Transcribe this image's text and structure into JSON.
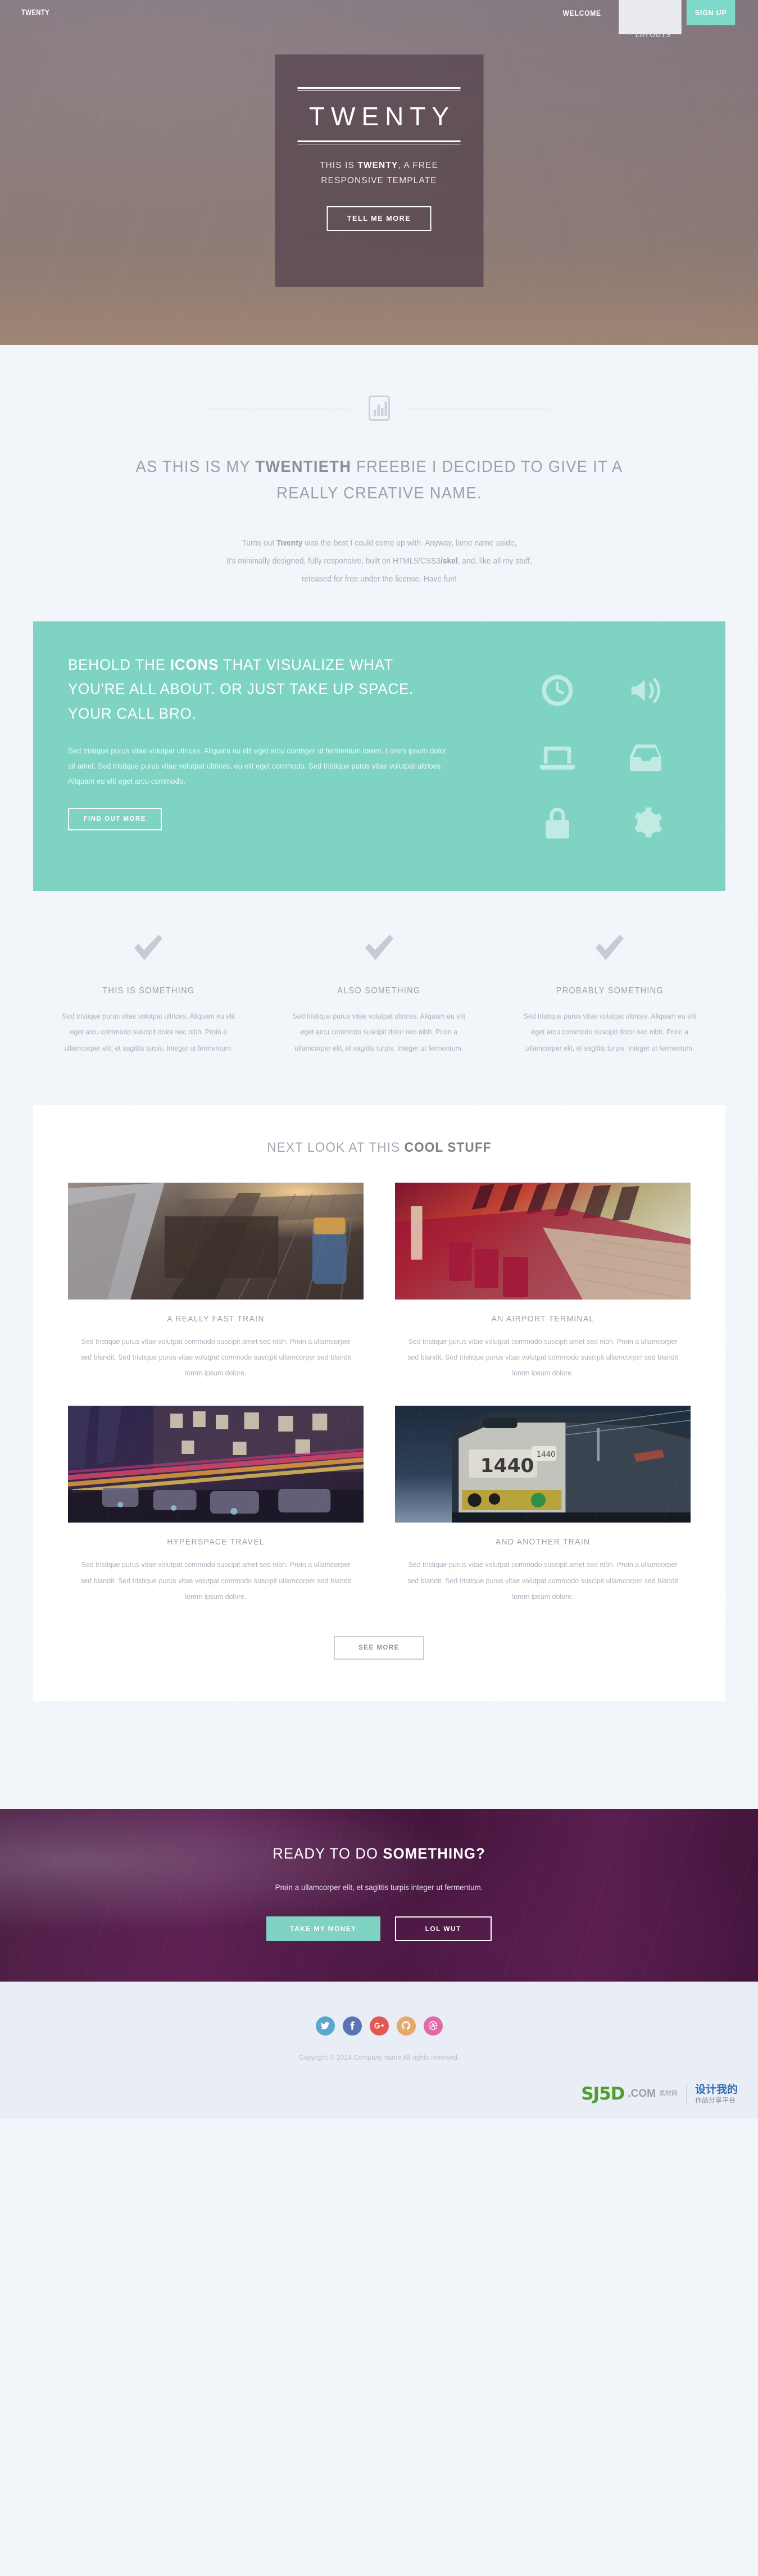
{
  "header": {
    "brand": "TWENTY",
    "nav": [
      {
        "label": "WELCOME",
        "style": "bold",
        "icon": null
      },
      {
        "label": "LAYOUTS",
        "style": "light",
        "icon": "chevron-down-icon"
      }
    ],
    "signup_label": "SIGN UP",
    "accent_teal": "#7ed3c3"
  },
  "hero": {
    "title": "TWENTY",
    "subtitle_pre": "THIS IS ",
    "subtitle_strong": "TWENTY",
    "subtitle_post": ", A FREE RESPONSIVE TEMPLATE",
    "button_label": "TELL ME MORE"
  },
  "intro": {
    "icon": "bar-chart-icon",
    "heading_pre": "AS THIS IS MY ",
    "heading_strong": "TWENTIETH",
    "heading_post": " FREEBIE I DECIDED TO GIVE IT A REALLY CREATIVE NAME.",
    "body_line1_pre": "Turns out ",
    "body_line1_strong": "Twenty",
    "body_line1_post": " was the best I could come up with. Anyway, lame name aside,",
    "body_line2_pre": "it's minimally designed, fully responsive, built on HTML5/CSS3",
    "body_line2_strong": "/skel",
    "body_line2_post": ", and, like all my stuff,",
    "body_line3": "released for free under the license. Have fun!"
  },
  "feature": {
    "bg_color": "#7ed3c3",
    "heading_pre": "BEHOLD THE ",
    "heading_strong": "ICONS",
    "heading_post": " THAT VISUALIZE WHAT YOU'RE ALL ABOUT. OR JUST TAKE UP SPACE. YOUR CALL BRO.",
    "paragraph": "Sed tristique purus vitae volutpat ultrices. Aliquam eu elit eget arcu contnger ut fermentum lorem. Lorem ipsum dolor sit amet. Sed tristique purus vitae volutpat ultrices. eu elit eget commodo. Sed tristique purus vitae volutpat ultrices. Aliquam eu elit eget arcu commodo.",
    "button_label": "FIND OUT MORE",
    "icons": [
      "clock-icon",
      "volume-icon",
      "laptop-icon",
      "inbox-icon",
      "lock-icon",
      "gear-icon"
    ]
  },
  "checks": {
    "body": "Sed tristique purus vitae volutpat ultrices. Aliquam eu elit eget arcu commodo suscipit dolor nec nibh. Proin a ullamcorper elit, et sagittis turpis. Integer ut fermentum.",
    "items": [
      {
        "icon": "check-icon",
        "title": "THIS IS SOMETHING"
      },
      {
        "icon": "check-icon",
        "title": "ALSO SOMETHING"
      },
      {
        "icon": "check-icon",
        "title": "PROBABLY SOMETHING"
      }
    ]
  },
  "gallery": {
    "heading_pre": "NEXT LOOK AT THIS ",
    "heading_strong": "COOL STUFF",
    "card_body": "Sed tristique purus vitae volutpat commodo suscipit amet sed nibh. Proin a ullamcorper sed blandit. Sed tristique purus vitae volutpat commodo suscipit ullamcorper sed blandit lorem ipsum dolore.",
    "cards": [
      {
        "title": "A REALLY FAST TRAIN",
        "image": "train-tracks-sunset-photo"
      },
      {
        "title": "AN AIRPORT TERMINAL",
        "image": "airport-terminal-red-seats-photo"
      },
      {
        "title": "HYPERSPACE TRAVEL",
        "image": "night-city-light-trails-photo"
      },
      {
        "title": "AND ANOTHER TRAIN",
        "image": "locomotive-1440-night-photo"
      }
    ],
    "see_more_label": "SEE MORE"
  },
  "cta": {
    "heading_pre": "READY TO DO ",
    "heading_strong": "SOMETHING?",
    "paragraph": "Proin a ullamcorper elit, et sagittis turpis integer ut fermentum.",
    "primary_label": "TAKE MY MONEY",
    "secondary_label": "LOL WUT"
  },
  "footer": {
    "socials": [
      {
        "name": "twitter-icon",
        "color": "#5aa8cd"
      },
      {
        "name": "facebook-icon",
        "color": "#5b74b5"
      },
      {
        "name": "googleplus-icon",
        "color": "#e05a52"
      },
      {
        "name": "github-icon",
        "color": "#e4a96d"
      },
      {
        "name": "dribbble-icon",
        "color": "#e069a8"
      }
    ],
    "copyright": "Copyright © 2014.Company name All rights reserved.",
    "watermark": {
      "sj": "SJ5D",
      "com": ".COM",
      "cn_small": "素材网",
      "cn_blue": "设计我的",
      "cn_grey": "作品分享平台"
    }
  }
}
